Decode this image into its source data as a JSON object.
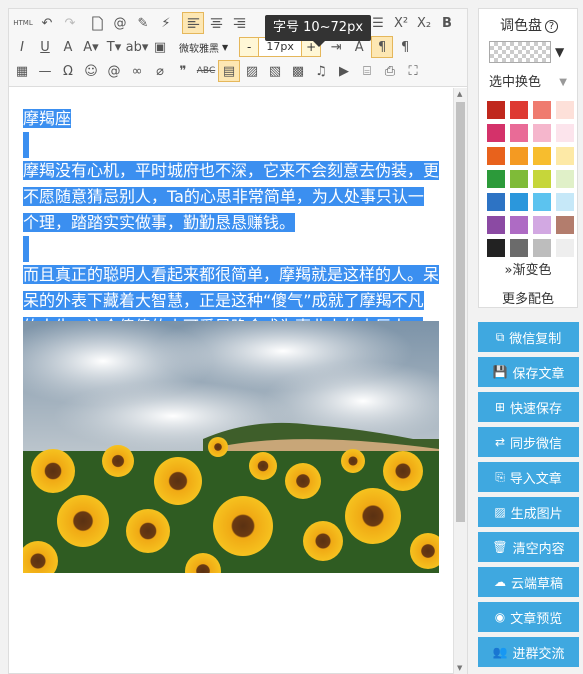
{
  "tooltip": "字号 10~72px",
  "toolbar": {
    "html_label": "HTML",
    "font_family": "微软雅黑",
    "font_size": "17px",
    "decrease_label": "-",
    "increase_label": "+"
  },
  "content": {
    "title": "摩羯座",
    "paragraph1": "摩羯没有心机，平时城府也不深，它来不会刻意去伪装，更不愿随意猜忌别人，Ta的心思非常简单，为人处事只认一个理，踏踏实实做事，勤勤恳恳赚钱。",
    "paragraph2": "而且真正的聪明人看起来都很简单，摩羯就是这样的人。呆呆的外表下藏着大智慧，正是这种“傻气”成就了摩羯不凡的人生，这个傻傻的小可爱早晚会成为事业上的大巨人。"
  },
  "palette": {
    "title": "调色盘",
    "help": "?",
    "select_label": "选中换色",
    "gradient_label": "渐变色",
    "more_label": "更多配色",
    "colors": [
      "#c0281d",
      "#de3a32",
      "#ef7b6f",
      "#fde0d9",
      "#d4326a",
      "#e96b97",
      "#f5b6cc",
      "#fce4ec",
      "#e8621c",
      "#f49a22",
      "#f7bd2e",
      "#fde9a6",
      "#2c9a3a",
      "#7fbb38",
      "#c6d63a",
      "#e0f0c8",
      "#2d73c4",
      "#2b97dc",
      "#5cc3ef",
      "#c6e8f8",
      "#8b4aa3",
      "#ae6bc4",
      "#d2a8e2",
      "#b37d6d",
      "#222222",
      "#6b6b6b",
      "#bdbdbd",
      "#eeeeee"
    ]
  },
  "actions": [
    {
      "label": "微信复制",
      "icon": "copy-icon"
    },
    {
      "label": "保存文章",
      "icon": "save-icon"
    },
    {
      "label": "快速保存",
      "icon": "plus-icon"
    },
    {
      "label": "同步微信",
      "icon": "sync-icon"
    },
    {
      "label": "导入文章",
      "icon": "import-icon"
    },
    {
      "label": "生成图片",
      "icon": "image-icon"
    },
    {
      "label": "清空内容",
      "icon": "trash-icon"
    },
    {
      "label": "云端草稿",
      "icon": "cloud-draft-icon"
    },
    {
      "label": "文章预览",
      "icon": "eye-icon"
    },
    {
      "label": "进群交流",
      "icon": "group-icon"
    }
  ]
}
